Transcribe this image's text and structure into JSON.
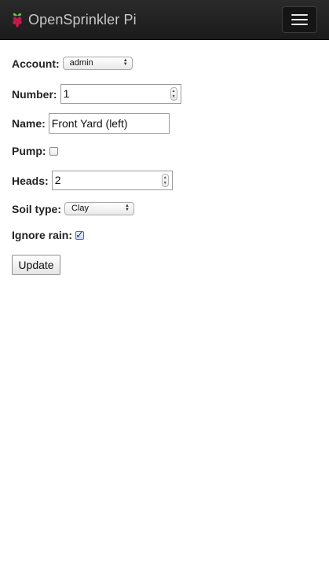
{
  "header": {
    "logo_icon": "raspberry-pi-icon",
    "title": "OpenSprinkler Pi",
    "menu_icon": "hamburger-menu-icon"
  },
  "form": {
    "account": {
      "label": "Account:",
      "value": "admin"
    },
    "number": {
      "label": "Number:",
      "value": "1"
    },
    "name": {
      "label": "Name:",
      "value": "Front Yard (left)"
    },
    "pump": {
      "label": "Pump:",
      "checked": false
    },
    "heads": {
      "label": "Heads:",
      "value": "2"
    },
    "soil_type": {
      "label": "Soil type:",
      "value": "Clay"
    },
    "ignore_rain": {
      "label": "Ignore rain:",
      "checked": true
    },
    "update_label": "Update"
  },
  "colors": {
    "navbar_bg": "#1f1f1f",
    "brand_text": "#c8c8c8",
    "raspberry_red": "#c51a4a",
    "raspberry_leaf": "#6cc24a"
  }
}
